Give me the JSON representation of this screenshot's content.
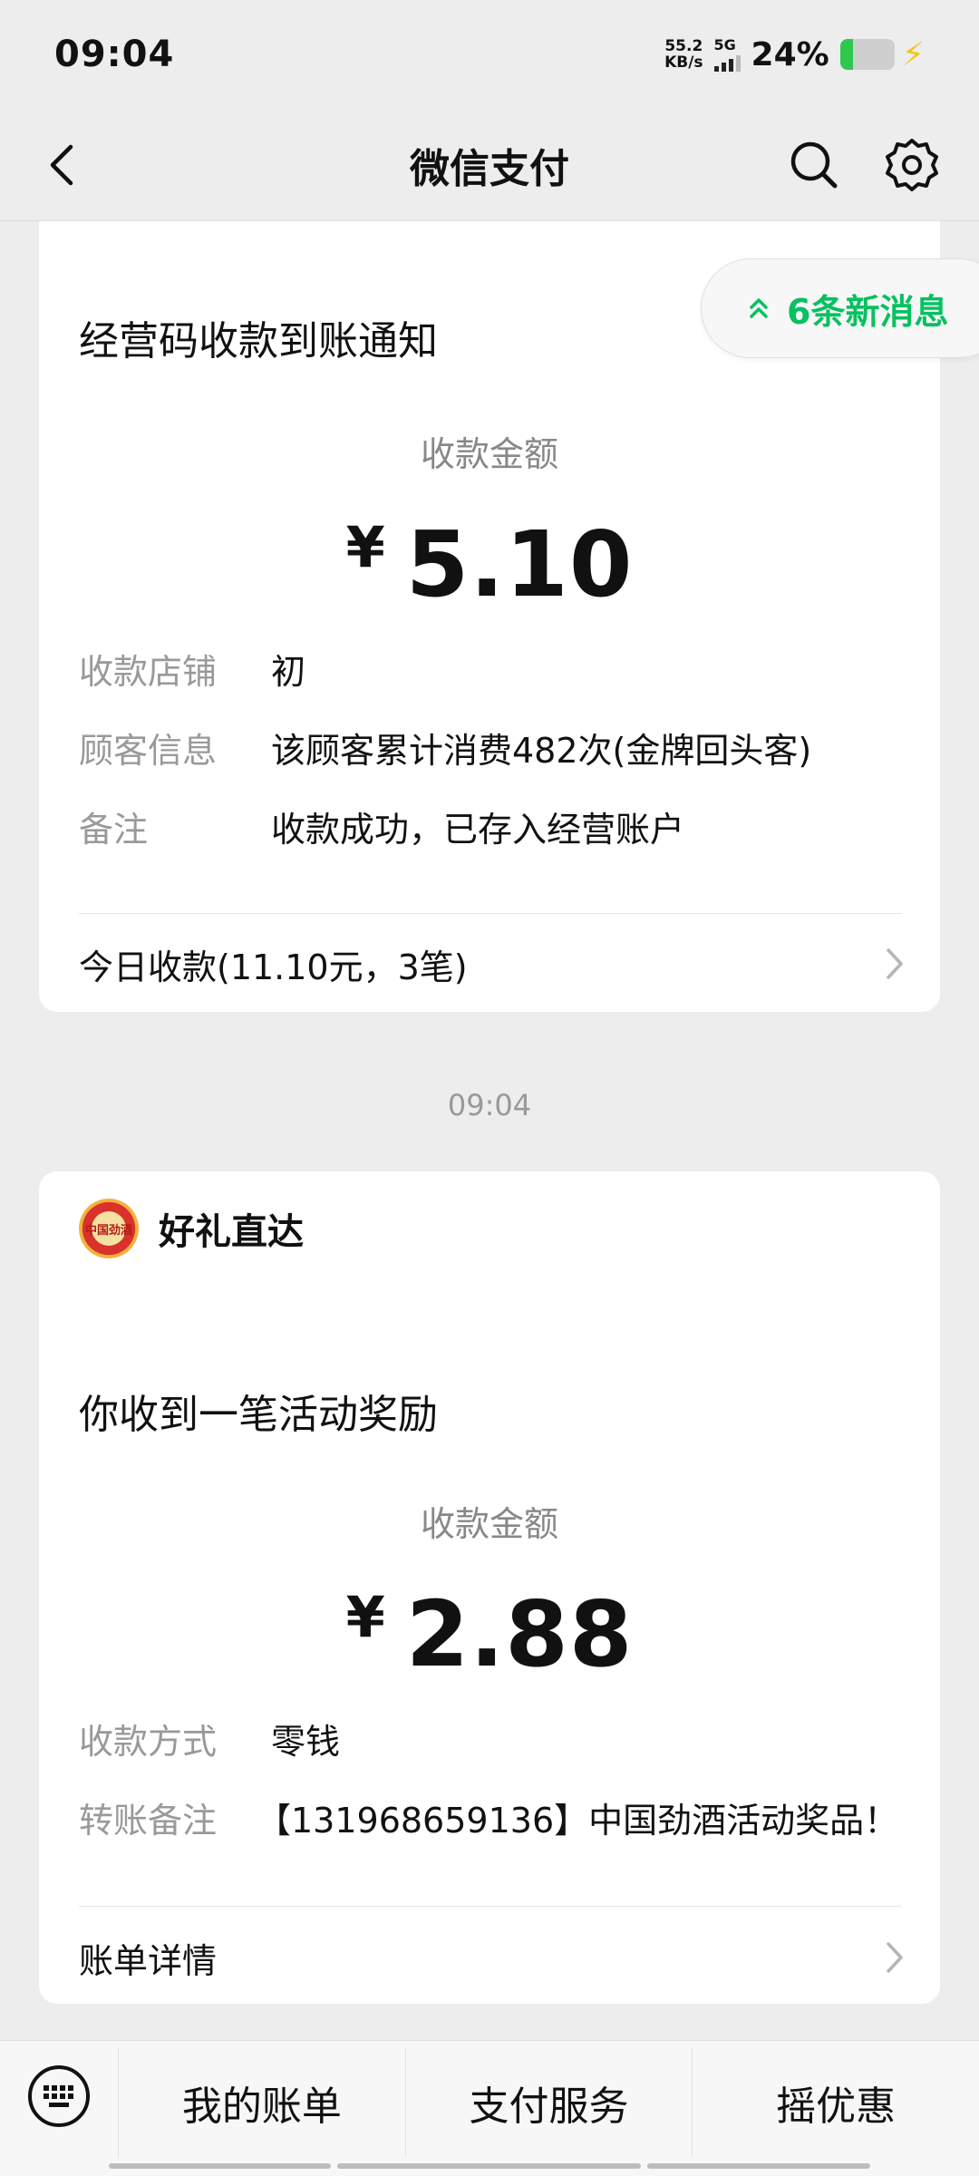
{
  "status_bar": {
    "time": "09:04",
    "net_speed_value": "55.2",
    "net_speed_unit": "KB/s",
    "network": "5G",
    "battery_percent_label": "24%",
    "battery_level": 0.24,
    "charging_icon": "bolt-icon"
  },
  "header": {
    "title": "微信支付",
    "back_icon": "chevron-left-icon",
    "search_icon": "search-icon",
    "settings_icon": "gear-icon"
  },
  "new_messages": {
    "label": "6条新消息",
    "icon": "double-chevron-up-icon"
  },
  "notice_1": {
    "heading": "经营码收款到账通知",
    "amount_label": "收款金额",
    "currency": "¥",
    "amount": "5.10",
    "rows": [
      {
        "label": "收款店铺",
        "value": "初"
      },
      {
        "label": "顾客信息",
        "value": "该顾客累计消费482次(金牌回头客)"
      },
      {
        "label": "备注",
        "value": "收款成功，已存入经营账户"
      }
    ],
    "footer": "今日收款(11.10元，3笔)"
  },
  "timestamp": "09:04",
  "notice_2": {
    "brand_name": "好礼直达",
    "brand_logo_text": "中国劲酒",
    "heading": "你收到一笔活动奖励",
    "amount_label": "收款金额",
    "currency": "¥",
    "amount": "2.88",
    "rows": [
      {
        "label": "收款方式",
        "value": "零钱"
      },
      {
        "label": "转账备注",
        "value": "【131968659136】中国劲酒活动奖品！"
      }
    ],
    "footer": "账单详情"
  },
  "bottom_menu": {
    "keyboard_icon": "keyboard-icon",
    "items": [
      "我的账单",
      "支付服务",
      "摇优惠"
    ]
  },
  "colors": {
    "accent": "#07c160",
    "background": "#ededed",
    "card": "#ffffff"
  }
}
